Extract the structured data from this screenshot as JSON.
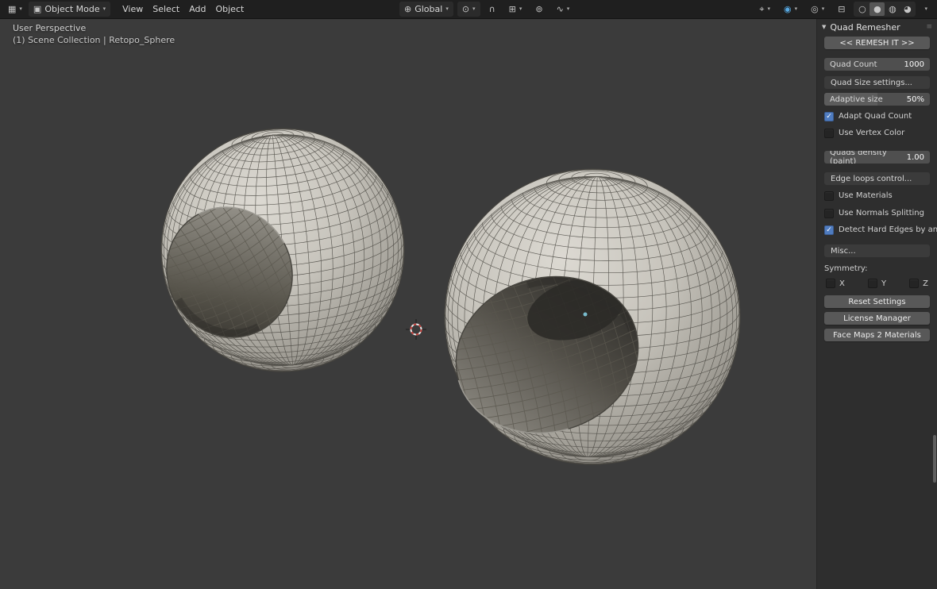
{
  "colors": {
    "accent": "#4f7cc0",
    "header_bg": "#1f1f1f",
    "viewport_bg": "#3b3b3b",
    "panel_bg": "#2e2e2e"
  },
  "icons": {
    "editor_type": "▦",
    "dropdown": "▾",
    "mode_cube": "▣",
    "globe": "⊕",
    "pivot": "⊙",
    "magnet": "∩",
    "snap_to": "⊞",
    "proportional": "⊚",
    "falloff": "∿",
    "gizmo": "⌖",
    "overlay_active": "◉",
    "overlays": "◎",
    "xray": "⊟",
    "wireframe": "○",
    "solid": "●",
    "material": "◍",
    "rendered": "◕",
    "collapse": "▼",
    "grip": "≡",
    "check": "✓"
  },
  "header": {
    "mode": "Object Mode",
    "menus": [
      {
        "label": "View"
      },
      {
        "label": "Select"
      },
      {
        "label": "Add"
      },
      {
        "label": "Object"
      }
    ],
    "orientation": "Global"
  },
  "viewport": {
    "perspective_label": "User Perspective",
    "collection_label": "(1) Scene Collection | Retopo_Sphere"
  },
  "panel": {
    "title": "Quad Remesher",
    "remesh_button": "<< REMESH IT >>",
    "fields": {
      "quad_count": {
        "label": "Quad Count",
        "value": "1000"
      },
      "adaptive_size": {
        "label": "Adaptive size",
        "value": "50%"
      },
      "quads_density": {
        "label": "Quads density (paint)",
        "value": "1.00"
      }
    },
    "buttons": {
      "quad_size_settings": "Quad Size settings...",
      "edge_loops": "Edge loops control...",
      "misc": "Misc...",
      "reset": "Reset Settings",
      "license": "License Manager",
      "face_maps": "Face Maps 2 Materials"
    },
    "checkboxes": {
      "adapt_quad_count": {
        "label": "Adapt Quad Count",
        "checked": true
      },
      "use_vertex_color": {
        "label": "Use Vertex Color",
        "checked": false
      },
      "use_materials": {
        "label": "Use Materials",
        "checked": false
      },
      "use_normals_splitting": {
        "label": "Use Normals Splitting",
        "checked": false
      },
      "detect_hard_edges": {
        "label": "Detect Hard Edges by angle",
        "checked": true
      }
    },
    "symmetry": {
      "label": "Symmetry:",
      "axes": [
        {
          "label": "X",
          "checked": false
        },
        {
          "label": "Y",
          "checked": false
        },
        {
          "label": "Z",
          "checked": false
        }
      ]
    }
  }
}
